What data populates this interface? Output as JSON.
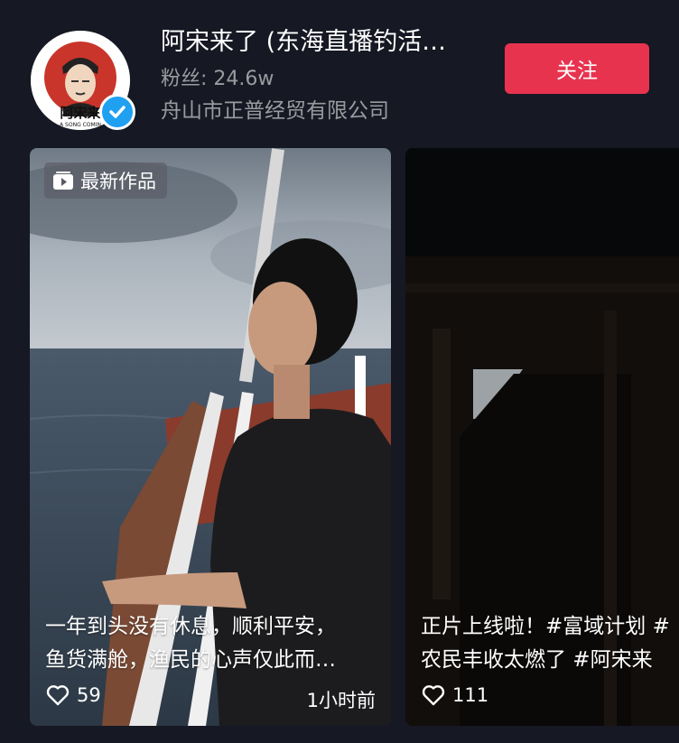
{
  "profile": {
    "name": "阿宋来了 (东海直播钓活…",
    "fans": "粉丝: 24.6w",
    "company": "舟山市正普经贸有限公司",
    "avatar_text": "阿宋来",
    "avatar_subtext": "A SONG COMIN",
    "follow_label": "关注",
    "accent_color": "#e8334f",
    "verified_color": "#20a0f0"
  },
  "videos": [
    {
      "badge": "最新作品",
      "caption_line1": "一年到头没有休息，顺利平安，",
      "caption_line2": "鱼货满舱，渔民的心声仅此而…",
      "likes": "59",
      "time": "1小时前"
    },
    {
      "caption_line1": "正片上线啦！#富域计划 #",
      "caption_line2": "农民丰收太燃了 #阿宋来",
      "likes": "111"
    }
  ]
}
